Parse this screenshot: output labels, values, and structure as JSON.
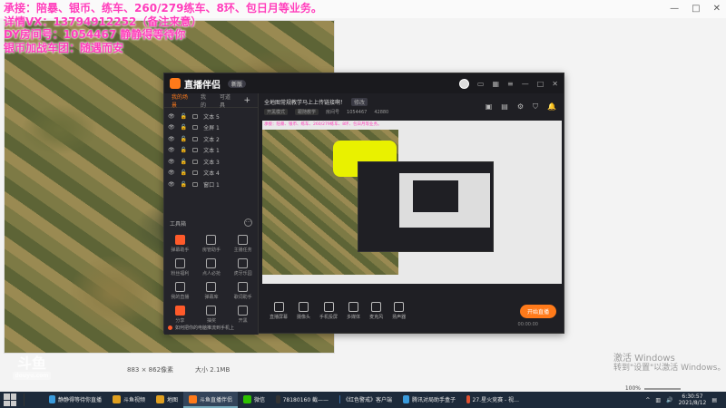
{
  "overlay_text": [
    "承接：陪暴、银币、练车、260/279练车、8环、包日月等业务。",
    "详情VX：13794912252（备注来意）",
    "DY房间号：1054467 静静得等待你",
    "银币加战车团：随遇而安"
  ],
  "viewer": {
    "win_min": "—",
    "win_max": "□",
    "win_close": "✕",
    "status_dims": "883 × 862像素",
    "status_size": "大小 2.1MB"
  },
  "watermark": {
    "logo": "斗鱼",
    "sub": "douyu.com"
  },
  "activate": {
    "line1": "激活 Windows",
    "line2": "转到\"设置\"以激活 Windows。"
  },
  "zoom": {
    "value": "100%"
  },
  "app": {
    "name": "直播伴侣",
    "version": "新版",
    "tabs": [
      "我的场景",
      "我的",
      "可道具"
    ],
    "add_label": "+",
    "sources": [
      "文本 5",
      "全屏 1",
      "文本 2",
      "文本 1",
      "文本 3",
      "文本 4",
      "窗口 1"
    ],
    "tools_title": "工具箱",
    "tools_more": "···",
    "tools": [
      "弹幕助手",
      "房管助手",
      "主播任务",
      "粉丝福利",
      "点人必抢",
      "虎牙乐园",
      "我的直播",
      "弹幕库",
      "歌词助手",
      "分享",
      "抽奖",
      "开黑"
    ],
    "hint": "如何把你的电脑推流到手机上",
    "stream_title": "全地图常规教学马上上传链接啊！",
    "stream_title_btn": "修改",
    "sub_category": "开黑模式",
    "sub_area": "跟随教学",
    "sub_room_label": "房间号",
    "sub_room": "1054467",
    "sub_hot": "42880",
    "preview_text": "承接：陪暴、银币、练车、260/279练车、8环、包日月等业务。",
    "bottom_tools": [
      "直播屏幕",
      "摄像头",
      "手机投屏",
      "多媒体",
      "麦克风",
      "扬声器"
    ],
    "start_label": "开始直播",
    "time": "00:00:00"
  },
  "taskbar": {
    "items": [
      {
        "label": "静静得等待你直播",
        "color": "#3a9bdc"
      },
      {
        "label": "斗鱼视频",
        "color": "#e0a020"
      },
      {
        "label": "地图",
        "color": "#e0a020"
      },
      {
        "label": "斗鱼直播伴侣",
        "color": "#ff7a1a"
      },
      {
        "label": "微信",
        "color": "#2dc100"
      },
      {
        "label": "78180160 截——",
        "color": "#333333"
      },
      {
        "label": "《红色警戒》客户端",
        "color": "#3a6ea5"
      },
      {
        "label": "腾讯对局助手盒子",
        "color": "#3a9bdc"
      },
      {
        "label": "27.星火竞赛 - 视…",
        "color": "#e05030"
      }
    ],
    "time": "6:30:57",
    "date": "2021/8/12"
  }
}
